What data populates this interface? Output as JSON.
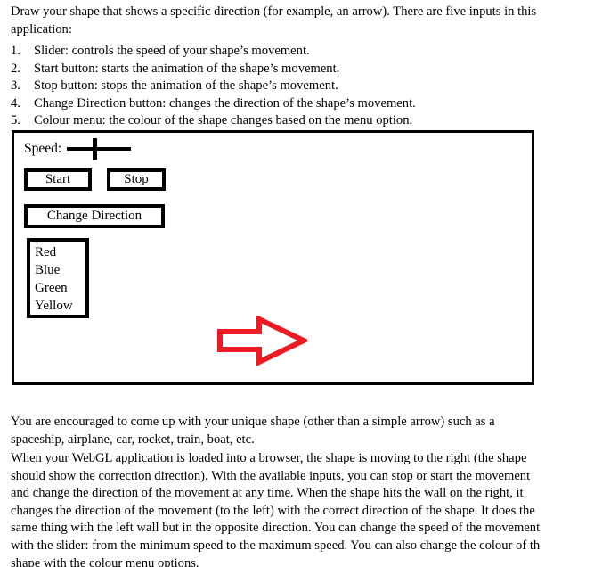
{
  "intro": {
    "lines": [
      "Draw your shape that shows a specific direction (for example, an arrow). There are five inputs in this",
      "application:"
    ]
  },
  "inputs_list": [
    {
      "number": "1.",
      "text": "Slider: controls the speed of your shape’s movement."
    },
    {
      "number": "2.",
      "text": "Start button: starts the animation of the shape’s movement."
    },
    {
      "number": "3.",
      "text": "Stop button: stops the animation of the shape’s movement."
    },
    {
      "number": "4.",
      "text": "Change Direction button: changes the direction of the shape’s movement."
    },
    {
      "number": "5.",
      "text": "Colour menu: the colour of the shape changes based on the menu option."
    }
  ],
  "mockup": {
    "speed_label": "Speed:",
    "slider": {
      "value_fraction": 0.42
    },
    "buttons": {
      "start": "Start",
      "stop": "Stop",
      "change_direction": "Change Direction"
    },
    "colour_menu": {
      "options": [
        "Red",
        "Blue",
        "Green",
        "Yellow"
      ]
    },
    "shape": {
      "name": "arrow",
      "direction": "right",
      "color": "#ED1C24"
    },
    "frame_color": "#000000"
  },
  "paragraphs": {
    "para_1": [
      "You are encouraged to come up with your unique shape (other than a simple arrow) such as a",
      "spaceship, airplane, car, rocket, train, boat, etc."
    ],
    "para_2": [
      "When your WebGL application is loaded into a browser, the shape is moving to the right (the shape",
      "should show the correction direction). With the available inputs, you can stop or start the movement",
      "and change the direction of the movement at any time. When the shape hits the wall on the right, it",
      "changes the direction of the movement (to the left) with the correct direction of the shape. It does the",
      "same thing with the left wall but in the opposite direction. You can change the speed of the movement",
      "with the slider: from the minimum speed to the maximum speed. You can also change the colour of th",
      "shape with the colour menu options."
    ]
  }
}
